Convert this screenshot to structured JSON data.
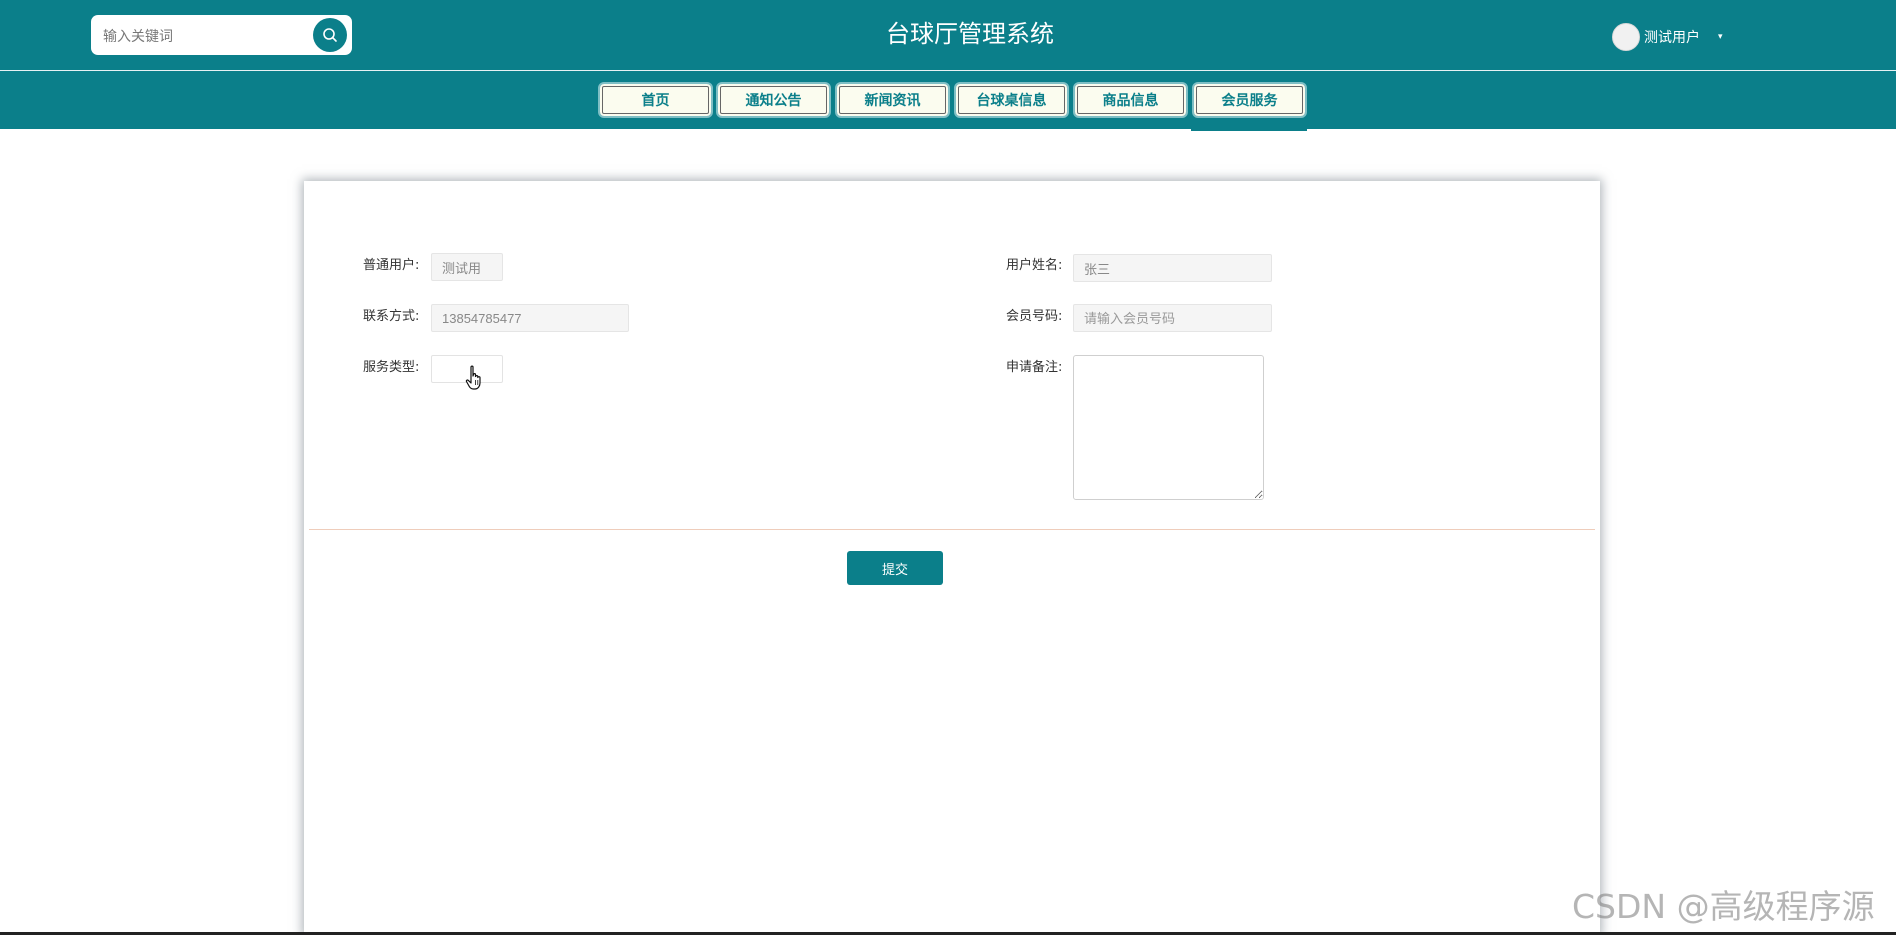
{
  "header": {
    "search_placeholder": "输入关键词",
    "title": "台球厅管理系统",
    "user_name": "测试用户",
    "user_caret": "▾"
  },
  "nav": {
    "items": [
      {
        "label": "首页"
      },
      {
        "label": "通知公告"
      },
      {
        "label": "新闻资讯"
      },
      {
        "label": "台球桌信息"
      },
      {
        "label": "商品信息"
      },
      {
        "label": "会员服务",
        "active": true
      }
    ]
  },
  "form": {
    "user_label": "普通用户:",
    "user_value": "测试用",
    "name_label": "用户姓名:",
    "name_value": "张三",
    "phone_label": "联系方式:",
    "phone_value": "13854785477",
    "member_no_label": "会员号码:",
    "member_no_placeholder": "请输入会员号码",
    "service_type_label": "服务类型:",
    "remark_label": "申请备注:",
    "submit_label": "提交"
  },
  "watermark": "CSDN @高级程序源",
  "colors": {
    "primary": "#0b7f8a",
    "nav_button_bg": "#fbfcef",
    "divider": "#efcdbb"
  }
}
